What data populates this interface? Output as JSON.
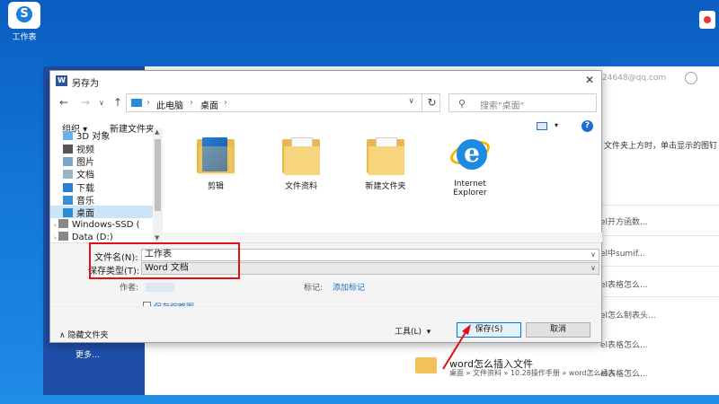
{
  "desktop": {
    "icon_label": "工作表"
  },
  "background_app": {
    "email": "24648@qq.com",
    "more": "更多...",
    "hint_text": "文件夹上方时，单击显示的图钉",
    "rows": [
      "el开方函数...",
      "el中sumif...",
      "el表格怎么...",
      "el怎么制表头...",
      "el表格怎么...",
      "el表格怎么..."
    ],
    "folder_title": "word怎么插入文件",
    "folder_path": "桌面 » 文件资料 » 10.28操作手册 » word怎么插入..."
  },
  "dialog": {
    "title": "另存为",
    "breadcrumb": [
      "此电脑",
      "桌面"
    ],
    "search_placeholder": "搜索\"桌面\"",
    "toolbar": {
      "organize": "组织 ▾",
      "new_folder": "新建文件夹"
    },
    "nav_items": [
      {
        "label": "3D 对象",
        "icon": "cube-icon"
      },
      {
        "label": "视频",
        "icon": "video-icon"
      },
      {
        "label": "图片",
        "icon": "pictures-icon"
      },
      {
        "label": "文档",
        "icon": "documents-icon"
      },
      {
        "label": "下载",
        "icon": "download-icon"
      },
      {
        "label": "音乐",
        "icon": "music-icon"
      },
      {
        "label": "桌面",
        "icon": "desktop-icon"
      },
      {
        "label": "Windows-SSD (",
        "icon": "drive-icon"
      },
      {
        "label": "Data (D:)",
        "icon": "drive-icon"
      }
    ],
    "files": [
      {
        "name": "剪辑",
        "type": "blue-folder"
      },
      {
        "name": "文件资料",
        "type": "folder"
      },
      {
        "name": "新建文件夹",
        "type": "folder"
      },
      {
        "name": "Internet Explorer",
        "type": "ie"
      }
    ],
    "form": {
      "filename_label": "文件名(N):",
      "filename_value": "工作表",
      "filetype_label": "保存类型(T):",
      "filetype_value": "Word 文档",
      "author_label": "作者:",
      "tags_label": "标记:",
      "tags_value": "添加标记",
      "thumbnail_label": "保存缩略图"
    },
    "footer": {
      "hide_folders": "隐藏文件夹",
      "tools": "工具(L)",
      "save": "保存(S)",
      "cancel": "取消"
    }
  },
  "colors": {
    "highlight": "#e0101a",
    "accent": "#0078d7"
  }
}
